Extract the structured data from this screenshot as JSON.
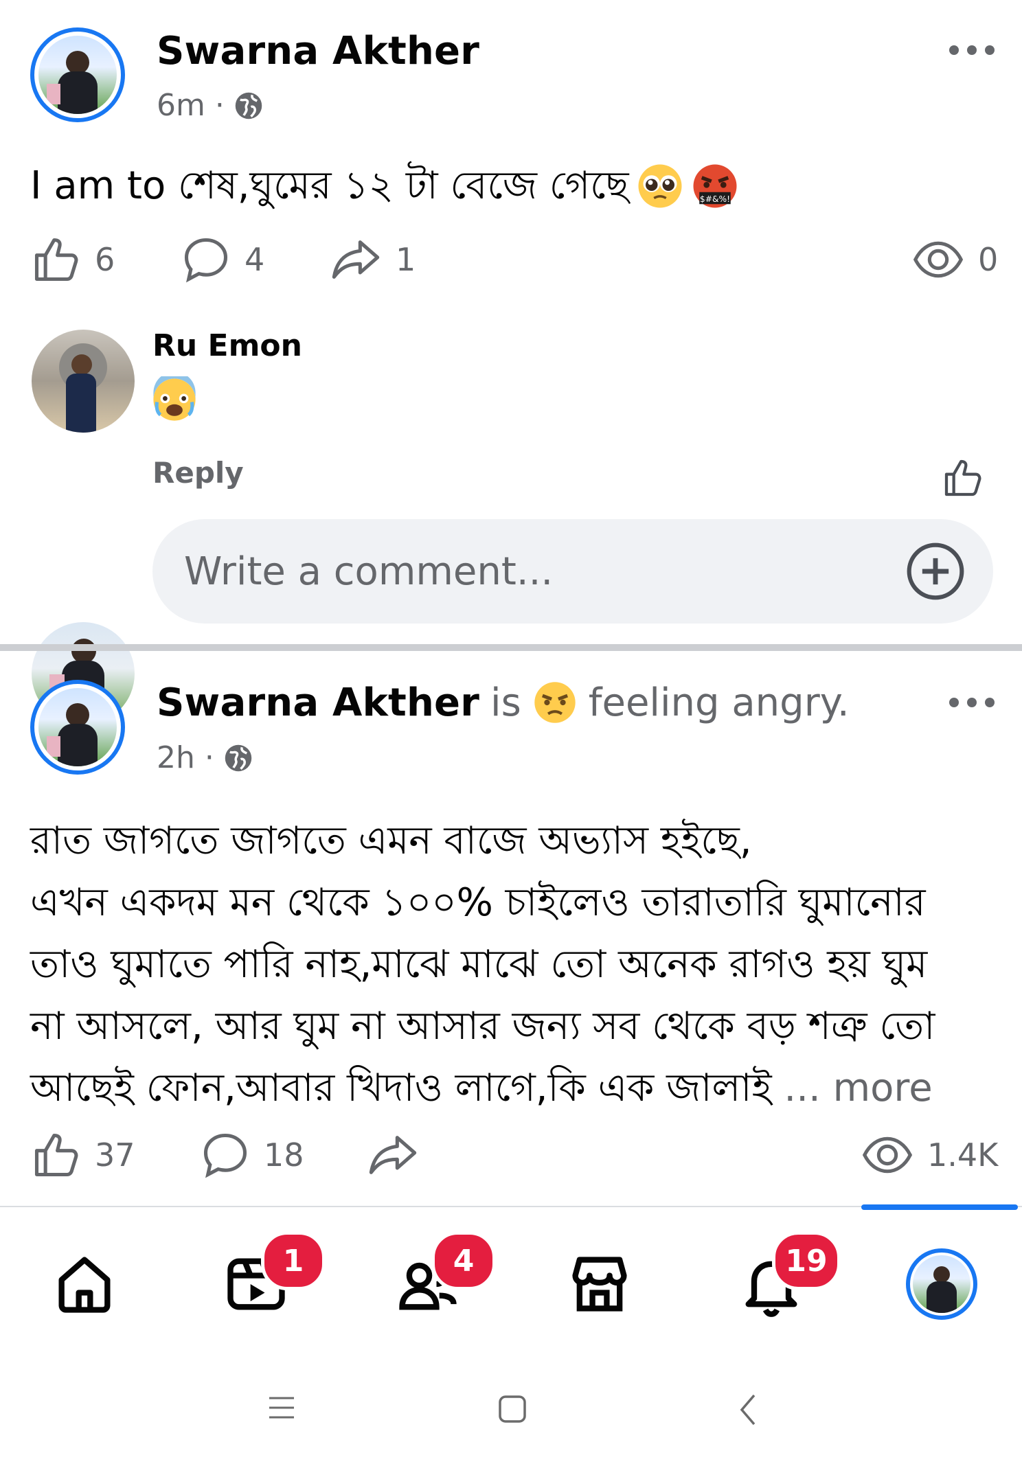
{
  "post1": {
    "author": "Swarna Akther",
    "time": "6m",
    "separator": "·",
    "text": "I am to শেষ,ঘুমের ১২ টা বেজে গেছে",
    "emojis": [
      "pleading-face-emoji",
      "cursing-face-emoji"
    ],
    "stats": {
      "likes": "6",
      "comments": "4",
      "shares": "1",
      "views": "0"
    },
    "comment": {
      "author": "Ru Emon",
      "emoji": "fearful-face-emoji",
      "reply_label": "Reply"
    },
    "comment_input": {
      "placeholder": "Write a comment..."
    }
  },
  "post2": {
    "author": "Swarna Akther",
    "is": "is",
    "feeling": "feeling angry.",
    "time": "2h",
    "separator": "·",
    "lines": [
      "রাত জাগতে জাগতে এমন বাজে অভ্যাস হইছে,",
      "এখন একদম মন থেকে ১০০% চাইলেও তারাতারি ঘুমানোর",
      "তাও ঘুমাতে পারি নাহ,মাঝে মাঝে তো অনেক রাগও হয় ঘুম",
      "না আসলে, আর ঘুম না আসার জন্য সব থেকে বড় শত্রু তো",
      "আছেই ফোন,আবার খিদাও লাগে,কি এক জালাই"
    ],
    "more": "... more",
    "stats": {
      "likes": "37",
      "comments": "18",
      "views": "1.4K"
    }
  },
  "nav": {
    "items": [
      {
        "name": "home",
        "badge": ""
      },
      {
        "name": "video",
        "badge": "1"
      },
      {
        "name": "friends",
        "badge": "4"
      },
      {
        "name": "marketplace",
        "badge": ""
      },
      {
        "name": "notifications",
        "badge": "19"
      },
      {
        "name": "profile",
        "badge": ""
      }
    ],
    "active": "profile"
  },
  "colors": {
    "accent": "#1877f2",
    "badge": "#e41e3f",
    "muted": "#65676b",
    "input_bg": "#f0f2f5"
  }
}
